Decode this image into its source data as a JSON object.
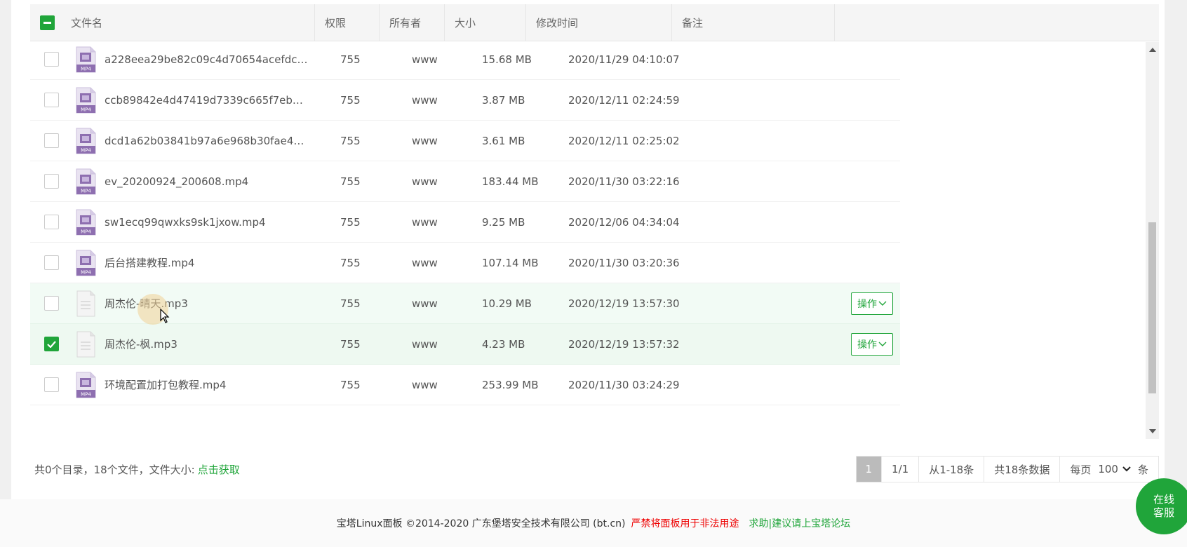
{
  "table": {
    "headers": {
      "name": "文件名",
      "perm": "权限",
      "owner": "所有者",
      "size": "大小",
      "mtime": "修改时间",
      "remark": "备注"
    },
    "rows": [
      {
        "name": "a228eea29be82c09c4d70654acefdce8....",
        "perm": "755",
        "owner": "www",
        "size": "15.68 MB",
        "mtime": "2020/11/29 04:10:07",
        "type": "mp4"
      },
      {
        "name": "ccb89842e4d47419d7339c665f7eb376...",
        "perm": "755",
        "owner": "www",
        "size": "3.87 MB",
        "mtime": "2020/12/11 02:24:59",
        "type": "mp4"
      },
      {
        "name": "dcd1a62b03841b97a6e968b30fae4d65...",
        "perm": "755",
        "owner": "www",
        "size": "3.61 MB",
        "mtime": "2020/12/11 02:25:02",
        "type": "mp4"
      },
      {
        "name": "ev_20200924_200608.mp4",
        "perm": "755",
        "owner": "www",
        "size": "183.44 MB",
        "mtime": "2020/11/30 03:22:16",
        "type": "mp4"
      },
      {
        "name": "sw1ecq99qwxks9sk1jxow.mp4",
        "perm": "755",
        "owner": "www",
        "size": "9.25 MB",
        "mtime": "2020/12/06 04:34:04",
        "type": "mp4"
      },
      {
        "name": "后台搭建教程.mp4",
        "perm": "755",
        "owner": "www",
        "size": "107.14 MB",
        "mtime": "2020/11/30 03:20:36",
        "type": "mp4"
      },
      {
        "name": "周杰伦-晴天.mp3",
        "perm": "755",
        "owner": "www",
        "size": "10.29 MB",
        "mtime": "2020/12/19 13:57:30",
        "type": "mp3",
        "op": "操作"
      },
      {
        "name": "周杰伦-枫.mp3",
        "perm": "755",
        "owner": "www",
        "size": "4.23 MB",
        "mtime": "2020/12/19 13:57:32",
        "type": "mp3",
        "op": "操作",
        "checked": true
      },
      {
        "name": "环境配置加打包教程.mp4",
        "perm": "755",
        "owner": "www",
        "size": "253.99 MB",
        "mtime": "2020/11/30 03:24:29",
        "type": "mp4"
      }
    ],
    "icon_label_mp4": "MP4"
  },
  "summary": {
    "text": "共0个目录，18个文件，文件大小:",
    "link": "点击获取"
  },
  "pager": {
    "current": "1",
    "total_pages": "1/1",
    "range": "从1-18条",
    "total": "共18条数据",
    "per_page_label": "每页",
    "per_page_value": "100",
    "unit": "条"
  },
  "footer": {
    "copyright": "宝塔Linux面板 ©2014-2020 广东堡塔安全技术有限公司 (bt.cn)",
    "warning": "严禁将面板用于非法用途",
    "help": "求助|建议请上宝塔论坛"
  },
  "chat": {
    "line1": "在线",
    "line2": "客服"
  },
  "colors": {
    "accent": "#20a53a",
    "warning": "#e00000",
    "video_icon": "#8e6fb0"
  }
}
